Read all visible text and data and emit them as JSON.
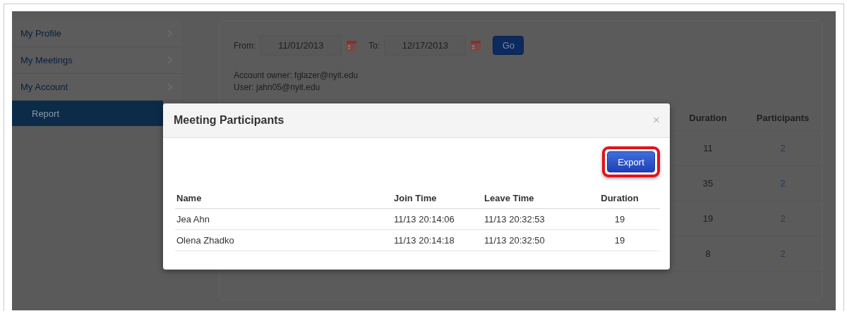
{
  "sidebar": {
    "items": [
      {
        "label": "My Profile",
        "kind": "parent",
        "selected": false
      },
      {
        "label": "My Meetings",
        "kind": "parent",
        "selected": false
      },
      {
        "label": "My Account",
        "kind": "parent",
        "selected": false
      },
      {
        "label": "Report",
        "kind": "child",
        "selected": true
      }
    ]
  },
  "filters": {
    "from_label": "From:",
    "from_value": "11/01/2013",
    "to_label": "To:",
    "to_value": "12/17/2013",
    "go_button": "Go"
  },
  "account": {
    "owner": "Account owner: fglazer@nyit.edu",
    "user": "User: jahn05@nyit.edu"
  },
  "report_table": {
    "columns": [
      "Duration",
      "Participants"
    ],
    "rows": [
      [
        "11",
        "2"
      ],
      [
        "35",
        "2"
      ],
      [
        "19",
        "2"
      ],
      [
        "8",
        "2"
      ]
    ]
  },
  "modal": {
    "title": "Meeting Participants",
    "close": "×",
    "export_button": "Export",
    "export_highlighted": true,
    "columns": [
      "Name",
      "Join Time",
      "Leave Time",
      "Duration"
    ],
    "rows": [
      [
        "Jea Ahn",
        "11/13 20:14:06",
        "11/13 20:32:53",
        "19"
      ],
      [
        "Olena Zhadko",
        "11/13 20:14:18",
        "11/13 20:32:50",
        "19"
      ]
    ]
  }
}
